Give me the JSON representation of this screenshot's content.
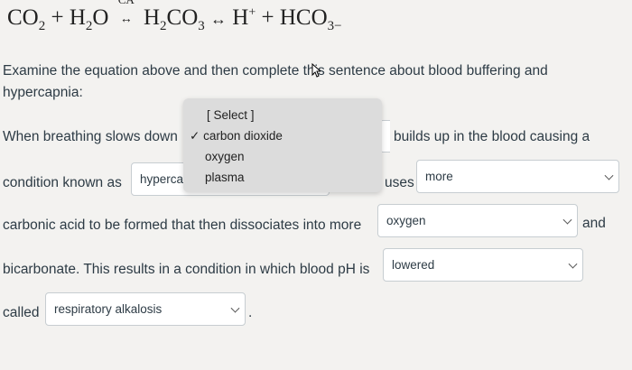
{
  "equation": {
    "co2": "CO",
    "co2_sub": "2",
    "plus1": "+",
    "h2o": "H",
    "h2o_sub": "2",
    "h2o_o": "O",
    "enzyme": "CA",
    "h2co3_h": "H",
    "h2co3_sub": "2",
    "h2co3_co": "CO",
    "h2co3_sub2": "3",
    "h_plus": "H",
    "h_plus_sup": "+",
    "plus2": "+",
    "hco3": "HCO",
    "hco3_sub": "3−"
  },
  "instructions": "Examine the equation above and then complete this sentence about blood buffering and hypercapnia:",
  "sentence": {
    "line1_start": "When breathing slows down",
    "line1_end": "builds up in the blood causing a",
    "line2_start": "condition known as",
    "line2_mid": "uses",
    "line3_start": "carbonic acid to be formed that then dissociates into more",
    "line3_end": "and",
    "line4_start": "bicarbonate. This results in a condition in which blood pH is",
    "line5_start": "called",
    "line5_end": "."
  },
  "selects": {
    "hyper_value": "hyperca",
    "causes_value": "more",
    "ion_value": "oxygen",
    "ph_value": "lowered",
    "condition_value": "respiratory alkalosis"
  },
  "dropdown": {
    "header": "[ Select ]",
    "options": [
      {
        "label": "carbon dioxide",
        "checked": true
      },
      {
        "label": "oxygen",
        "checked": false
      },
      {
        "label": "plasma",
        "checked": false
      }
    ],
    "check_glyph": "✓"
  }
}
